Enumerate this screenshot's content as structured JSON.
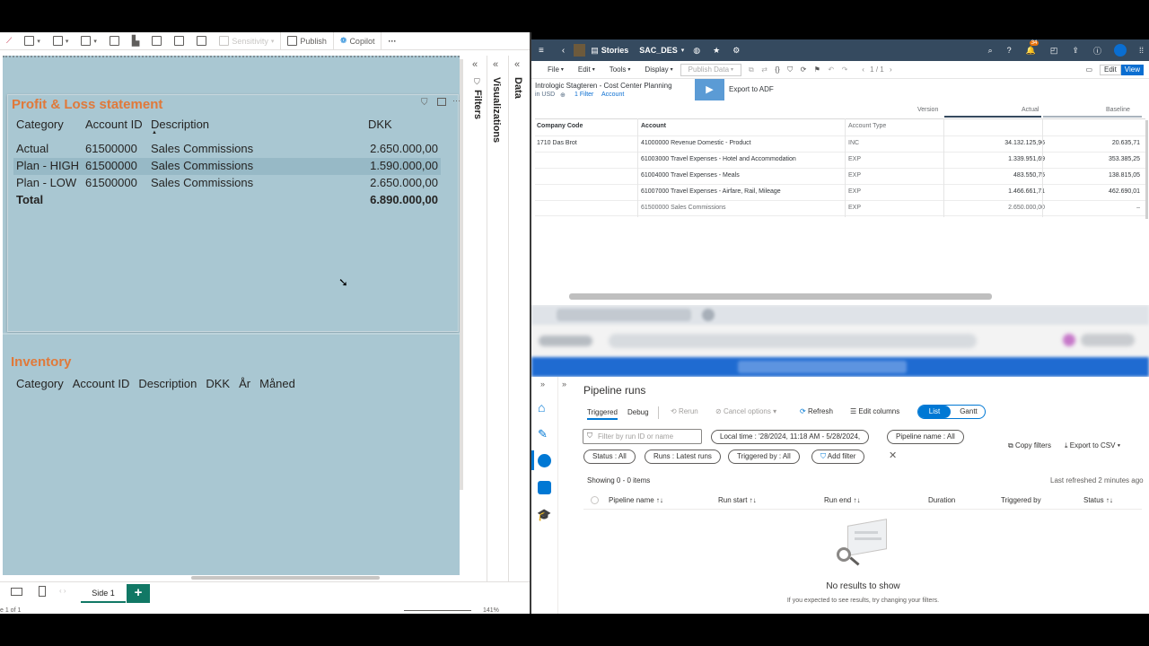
{
  "pbi": {
    "toolbar": {
      "sensitivity_label": "Sensitivity",
      "publish_label": "Publish",
      "copilot_label": "Copilot",
      "more_label": "···"
    },
    "pl_card": {
      "title": "Profit & Loss statement",
      "headers": {
        "category": "Category",
        "account_id": "Account ID",
        "description": "Description",
        "dkk": "DKK"
      },
      "rows": [
        {
          "category": "Actual",
          "account_id": "61500000",
          "description": "Sales Commissions",
          "dkk": "2.650.000,00"
        },
        {
          "category": "Plan - HIGH",
          "account_id": "61500000",
          "description": "Sales Commissions",
          "dkk": "1.590.000,00"
        },
        {
          "category": "Plan - LOW",
          "account_id": "61500000",
          "description": "Sales Commissions",
          "dkk": "2.650.000,00"
        }
      ],
      "total_label": "Total",
      "total_value": "6.890.000,00"
    },
    "inventory": {
      "title": "Inventory",
      "headers": [
        "Category",
        "Account ID",
        "Description",
        "DKK",
        "År",
        "Måned"
      ]
    },
    "side_panes": {
      "filters": "Filters",
      "visualizations": "Visualizations",
      "data": "Data"
    },
    "bottom": {
      "page_tab": "Side 1",
      "add_page": "+",
      "page_count": "e 1 of 1",
      "zoom": "141%"
    }
  },
  "sac": {
    "topbar": {
      "stories": "Stories",
      "file_name": "SAC_DES",
      "badge": "34"
    },
    "tools": {
      "file": "File",
      "edit": "Edit",
      "tools": "Tools",
      "display": "Display",
      "publish": "Publish Data",
      "pager": "1 / 1",
      "edit_btn": "Edit",
      "view_btn": "View"
    },
    "story_title": "Intrologic Stagteren - Cost Center Planning",
    "currency": "in USD",
    "filter_chip": "1 Filter",
    "account_chip": "Account",
    "export_label": "Export to ADF",
    "col_headers": {
      "version": "Version",
      "actual": "Actual",
      "baseline": "Baseline",
      "company_code": "Company Code",
      "account": "Account",
      "account_type": "Account Type"
    },
    "rows": [
      {
        "company": "1710 Das Brot",
        "account": "41000000 Revenue Domestic - Product",
        "type": "INC",
        "actual": "34.132.125,96",
        "baseline": "20.635,71"
      },
      {
        "company": "",
        "account": "61003000 Travel Expenses - Hotel and Accommodation",
        "type": "EXP",
        "actual": "1.339.951,69",
        "baseline": "353.385,25"
      },
      {
        "company": "",
        "account": "61004000 Travel Expenses - Meals",
        "type": "EXP",
        "actual": "483.550,75",
        "baseline": "138.815,05"
      },
      {
        "company": "",
        "account": "61007000 Travel Expenses - Airfare, Rail, Mileage",
        "type": "EXP",
        "actual": "1.466.661,71",
        "baseline": "462.690,01"
      },
      {
        "company": "",
        "account": "61500000 Sales Commissions",
        "type": "EXP",
        "actual": "2.650.000,00",
        "baseline": "–"
      }
    ]
  },
  "adf": {
    "page_title": "Pipeline runs",
    "tabs": {
      "triggered": "Triggered",
      "debug": "Debug"
    },
    "actions": {
      "rerun": "Rerun",
      "cancel": "Cancel options",
      "refresh": "Refresh",
      "edit_columns": "Edit columns",
      "list": "List",
      "gantt": "Gantt"
    },
    "filter_placeholder": "Filter by run ID or name",
    "pills": {
      "local_time": "Local time : '28/2024, 11:18 AM - 5/28/2024,",
      "pipeline_name": "Pipeline name : All",
      "status": "Status : All",
      "runs": "Runs : Latest runs",
      "triggered_by": "Triggered by : All",
      "add_filter": "Add filter"
    },
    "copy_filters": "Copy filters",
    "export_csv": "Export to CSV",
    "showing": "Showing 0 - 0 items",
    "last_refreshed": "Last refreshed 2 minutes ago",
    "columns": {
      "pipeline_name": "Pipeline name ↑↓",
      "run_start": "Run start ↑↓",
      "run_end": "Run end ↑↓",
      "duration": "Duration",
      "triggered_by": "Triggered by",
      "status": "Status ↑↓"
    },
    "empty_title": "No results to show",
    "empty_sub": "If you expected to see results, try changing your filters."
  },
  "colors": {
    "pbi_title": "#e0793a",
    "canvas": "#a9c7d2",
    "sac_bar": "#354a5f",
    "adf_blue": "#0078d4",
    "pbi_tab": "#117865"
  }
}
